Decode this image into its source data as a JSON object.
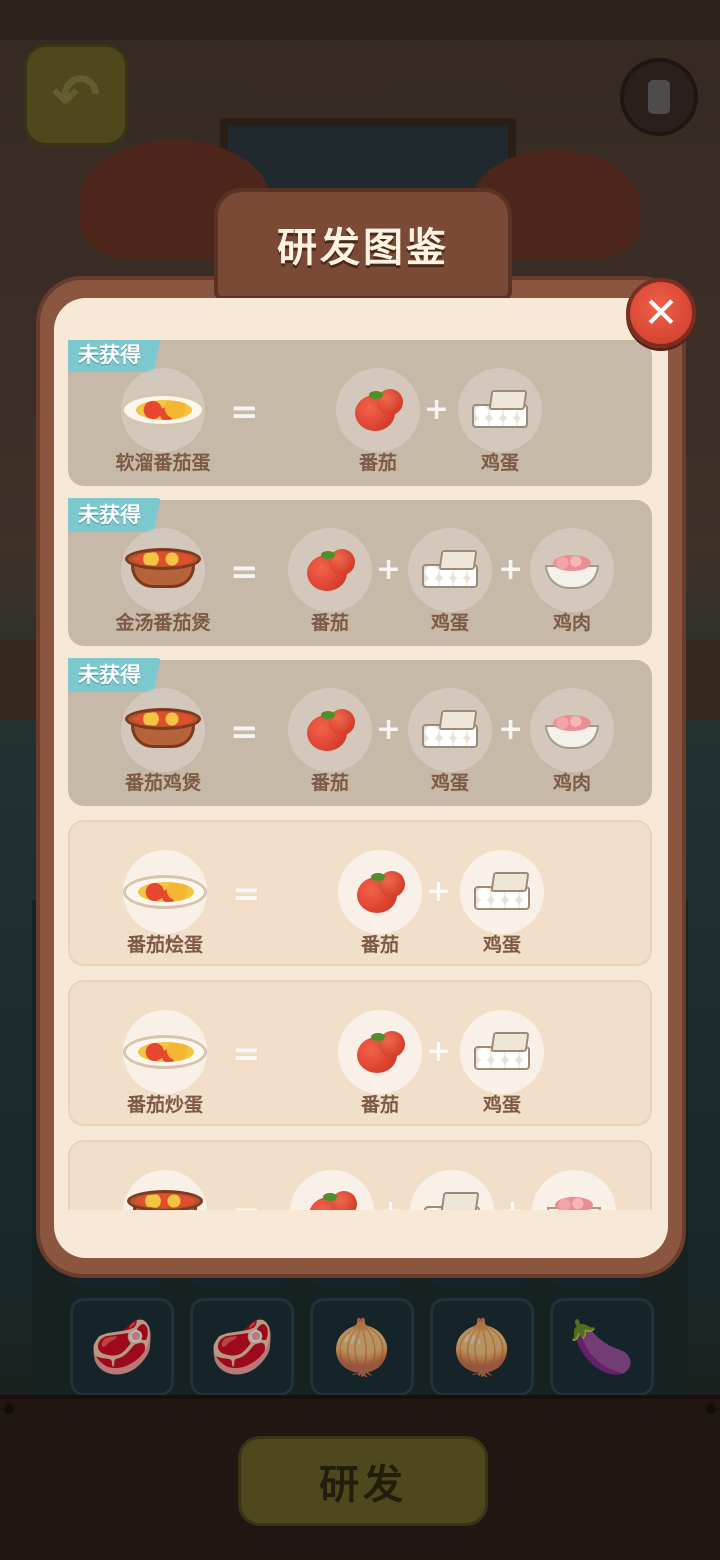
{
  "header": {
    "title": "研发图鉴",
    "close_symbol": "✕",
    "back_symbol": "↶"
  },
  "footer": {
    "develop_label": "研发"
  },
  "colors": {
    "modal_frame": "#8a563f",
    "modal_inner": "#f7e9d6",
    "locked_card": "#c7b9a8",
    "badge": "#7cc8cf",
    "close_button": "#e0513c"
  },
  "recipes": [
    {
      "status_label": "未获得",
      "locked": true,
      "dish": {
        "name": "软溜番茄蛋",
        "icon": "scrambled-egg-plate-icon"
      },
      "ingredients": [
        {
          "name": "番茄",
          "icon": "tomato-icon"
        },
        {
          "name": "鸡蛋",
          "icon": "egg-carton-icon"
        }
      ]
    },
    {
      "status_label": "未获得",
      "locked": true,
      "dish": {
        "name": "金汤番茄煲",
        "icon": "clay-pot-icon"
      },
      "ingredients": [
        {
          "name": "番茄",
          "icon": "tomato-icon"
        },
        {
          "name": "鸡蛋",
          "icon": "egg-carton-icon"
        },
        {
          "name": "鸡肉",
          "icon": "chicken-bowl-icon"
        }
      ]
    },
    {
      "status_label": "未获得",
      "locked": true,
      "dish": {
        "name": "番茄鸡煲",
        "icon": "clay-pot-icon"
      },
      "ingredients": [
        {
          "name": "番茄",
          "icon": "tomato-icon"
        },
        {
          "name": "鸡蛋",
          "icon": "egg-carton-icon"
        },
        {
          "name": "鸡肉",
          "icon": "chicken-bowl-icon"
        }
      ]
    },
    {
      "status_label": "",
      "locked": false,
      "dish": {
        "name": "番茄烩蛋",
        "icon": "scrambled-egg-plate-icon"
      },
      "ingredients": [
        {
          "name": "番茄",
          "icon": "tomato-icon"
        },
        {
          "name": "鸡蛋",
          "icon": "egg-carton-icon"
        }
      ]
    },
    {
      "status_label": "",
      "locked": false,
      "dish": {
        "name": "番茄炒蛋",
        "icon": "scrambled-egg-plate-icon"
      },
      "ingredients": [
        {
          "name": "番茄",
          "icon": "tomato-icon"
        },
        {
          "name": "鸡蛋",
          "icon": "egg-carton-icon"
        }
      ]
    },
    {
      "status_label": "",
      "locked": false,
      "dish": {
        "name": "",
        "icon": "clay-pot-icon"
      },
      "ingredients": [
        {
          "name": "",
          "icon": "tomato-icon"
        },
        {
          "name": "",
          "icon": "egg-carton-icon"
        },
        {
          "name": "",
          "icon": "chicken-bowl-icon"
        }
      ]
    }
  ],
  "operators": {
    "equals": "=",
    "plus": "+"
  },
  "background_ingredients": [
    {
      "icon": "beef-icon",
      "glyph": "🥩"
    },
    {
      "icon": "beef-icon",
      "glyph": "🥩"
    },
    {
      "icon": "onion-icon",
      "glyph": "🧅"
    },
    {
      "icon": "onion-icon",
      "glyph": "🧅"
    },
    {
      "icon": "eggplant-icon",
      "glyph": "🍆"
    }
  ]
}
